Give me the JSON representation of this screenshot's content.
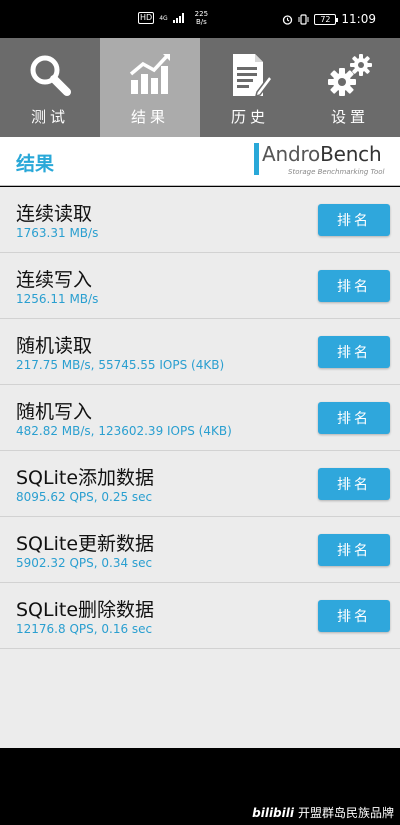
{
  "status_bar": {
    "hd": "HD",
    "network": "4G",
    "speed_value": "225",
    "speed_unit": "B/s",
    "battery": "72",
    "time": "11:09"
  },
  "tabs": [
    {
      "label": "测试",
      "icon": "magnifier-icon",
      "active": false
    },
    {
      "label": "结果",
      "icon": "chart-icon",
      "active": true
    },
    {
      "label": "历史",
      "icon": "document-pen-icon",
      "active": false
    },
    {
      "label": "设置",
      "icon": "gears-icon",
      "active": false
    }
  ],
  "header": {
    "title": "结果",
    "brand_name_part1": "Andro",
    "brand_name_part2": "Bench",
    "brand_tagline": "Storage Benchmarking Tool"
  },
  "results": [
    {
      "title": "连续读取",
      "value": "1763.31 MB/s",
      "button": "排名"
    },
    {
      "title": "连续写入",
      "value": "1256.11 MB/s",
      "button": "排名"
    },
    {
      "title": "随机读取",
      "value": "217.75 MB/s, 55745.55 IOPS (4KB)",
      "button": "排名"
    },
    {
      "title": "随机写入",
      "value": "482.82 MB/s, 123602.39 IOPS (4KB)",
      "button": "排名"
    },
    {
      "title": "SQLite添加数据",
      "value": "8095.62 QPS, 0.25 sec",
      "button": "排名"
    },
    {
      "title": "SQLite更新数据",
      "value": "5902.32 QPS, 0.34 sec",
      "button": "排名"
    },
    {
      "title": "SQLite删除数据",
      "value": "12176.8 QPS, 0.16 sec",
      "button": "排名"
    }
  ],
  "watermark": {
    "logo": "bilibili",
    "text": "开盟群岛民族品牌"
  },
  "colors": {
    "accent": "#29a8d8",
    "tabbar": "#6b6b6b",
    "tab_active": "#ababab",
    "list_bg": "#ececec"
  }
}
